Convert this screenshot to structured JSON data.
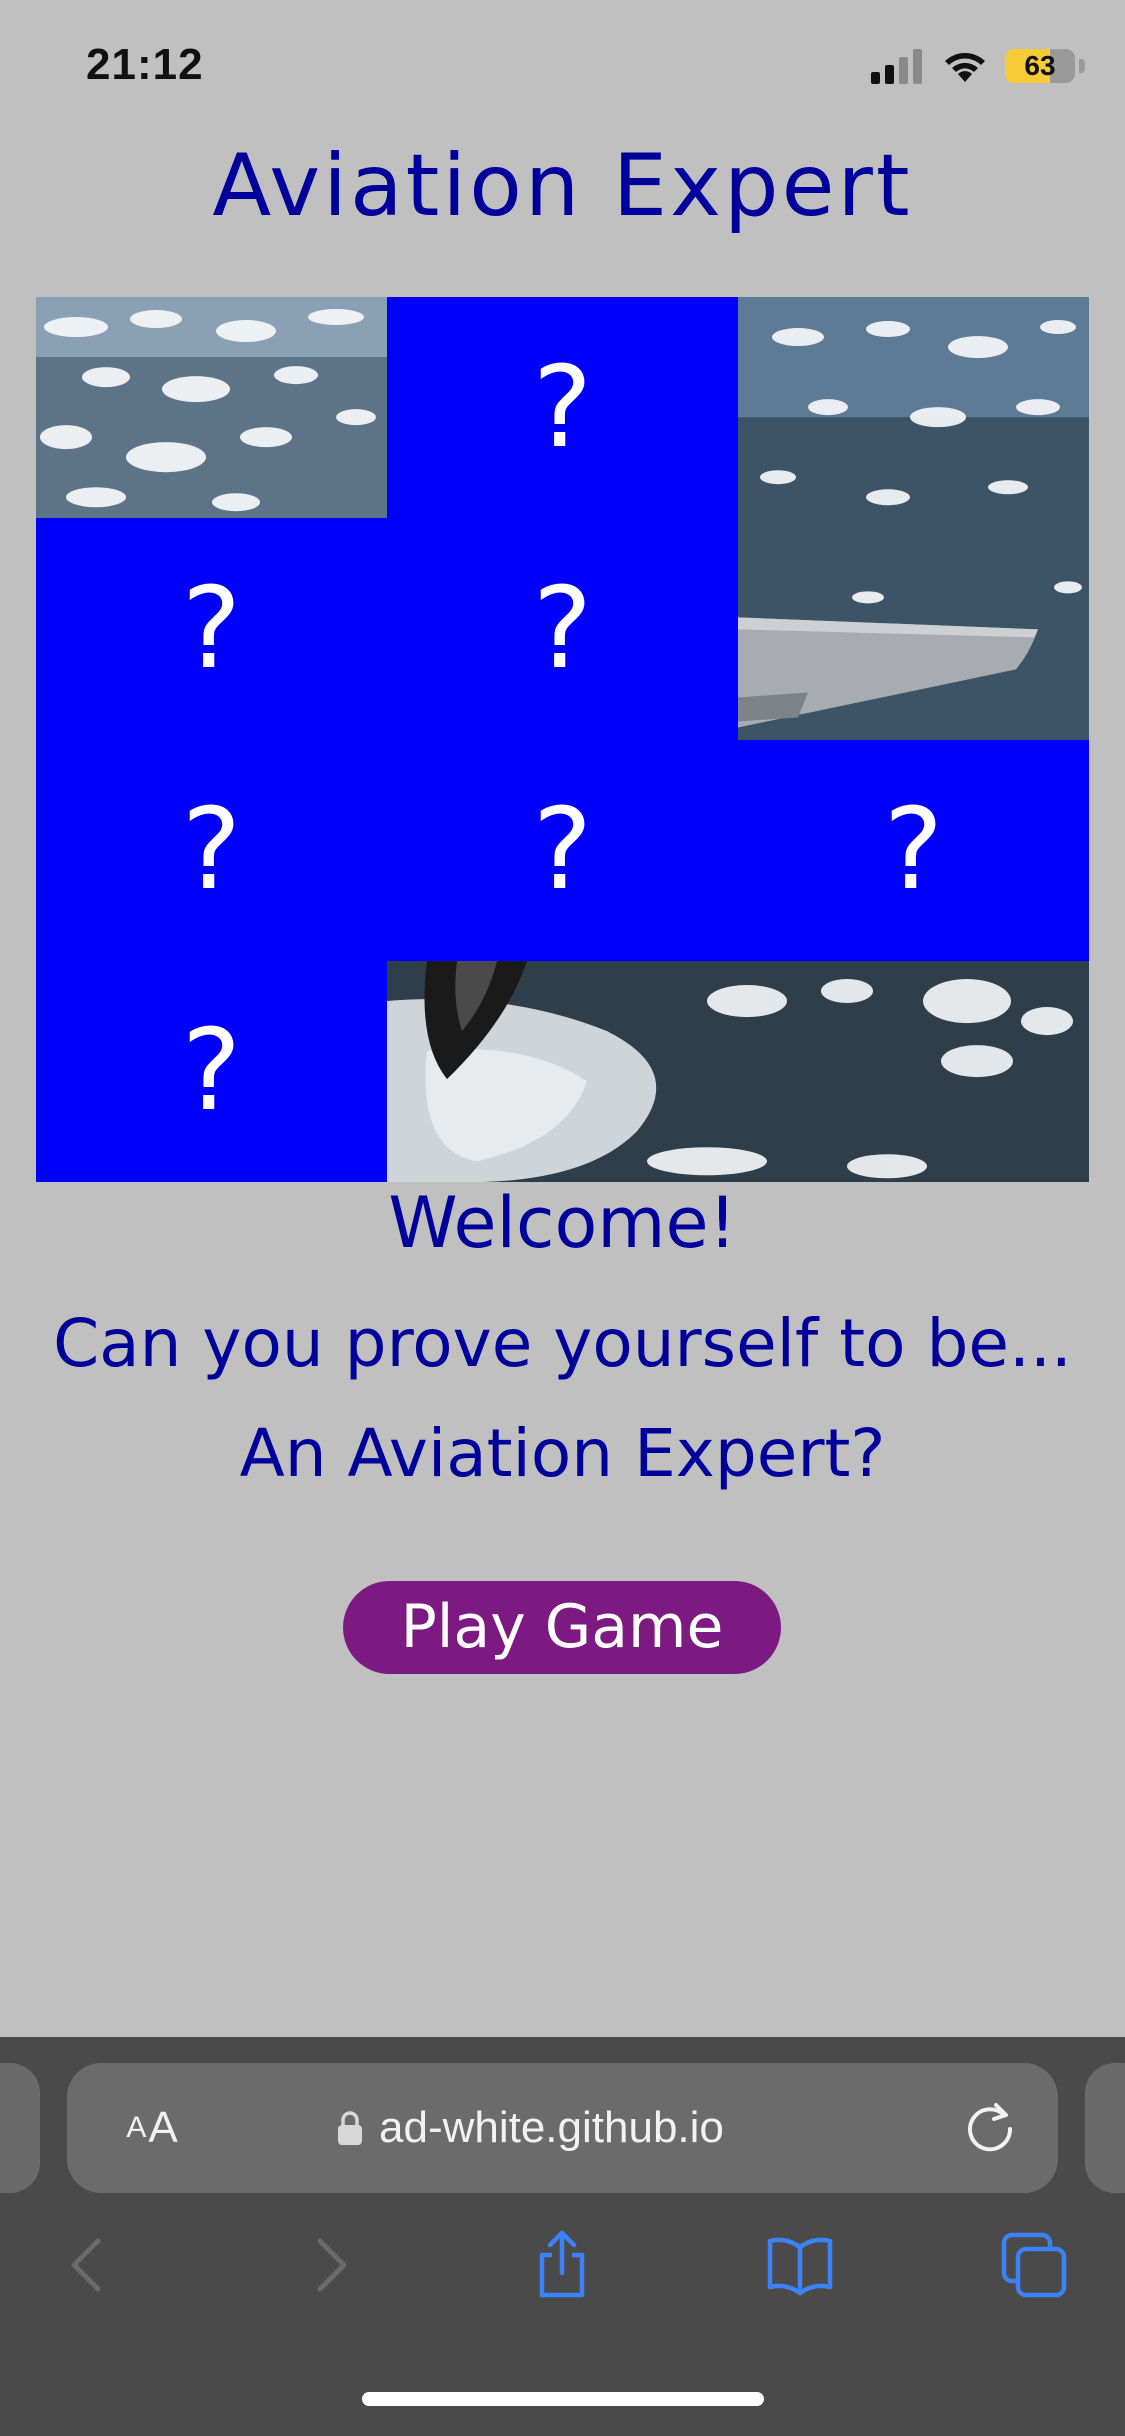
{
  "status_bar": {
    "time": "21:12",
    "battery_percent": "63",
    "battery_level": 0.63,
    "icons": [
      "cellular-signal-icon",
      "wifi-icon",
      "battery-icon"
    ]
  },
  "page": {
    "title": "Aviation Expert",
    "welcome": "Welcome!",
    "prompt": "Can you prove yourself to be...",
    "question": "An Aviation Expert?",
    "play_button": "Play Game"
  },
  "card_grid": {
    "hidden_symbol": "?",
    "revealed_cards": [
      "sky-clouds-photo",
      "aircraft-wing-photo",
      "aircraft-nose-photo"
    ]
  },
  "browser": {
    "text_size_small": "A",
    "text_size_large": "A",
    "url": "ad-white.github.io",
    "toolbar_icons": [
      "back-icon",
      "forward-icon",
      "share-icon",
      "bookmarks-icon",
      "tabs-icon"
    ]
  },
  "colors": {
    "background": "#c0c0c0",
    "title_text": "#00009a",
    "card_back": "#0000ff",
    "play_button": "#7d1a82",
    "chrome": "#4a4a4a",
    "accent_blue": "#3b82f6"
  }
}
